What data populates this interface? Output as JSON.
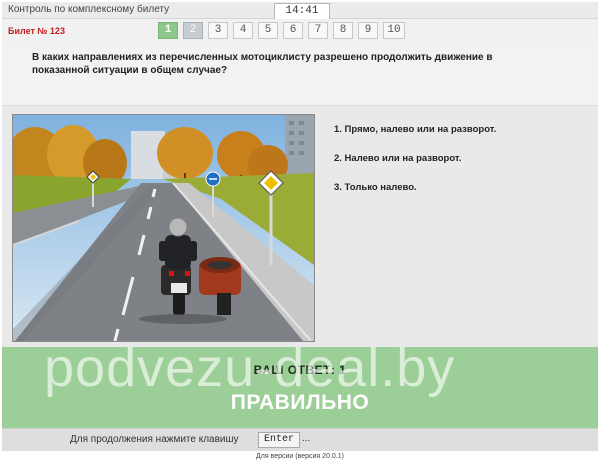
{
  "header": {
    "title": "Контроль по комплексному билету",
    "timer": "14:41"
  },
  "ticket": {
    "label": "Билет № 123"
  },
  "questions": [
    "1",
    "2",
    "3",
    "4",
    "5",
    "6",
    "7",
    "8",
    "9",
    "10"
  ],
  "current_question": "1",
  "question_text": "В каких направлениях из перечисленных мотоциклисту разрешено продолжить движение в показанной ситуации в общем случае?",
  "answers": [
    "1.  Прямо, налево или на разворот.",
    "2.  Налево или на разворот.",
    "3.  Только налево."
  ],
  "result": {
    "your_answer": "ВАШ  ОТВЕТ:   1",
    "verdict": "ПРАВИЛЬНО",
    "watermark": "podvezu-deal.by"
  },
  "footer": {
    "hint": "Для продолжения нажмите клавишу",
    "key": "Enter",
    "dots": "...",
    "version": "Для версии (версия 20.0.1)"
  },
  "colors": {
    "current": "#8fc78b",
    "result_bg": "#9ccf97",
    "ticket": "#c02020"
  },
  "icons": [
    "traffic-scene-illustration"
  ]
}
